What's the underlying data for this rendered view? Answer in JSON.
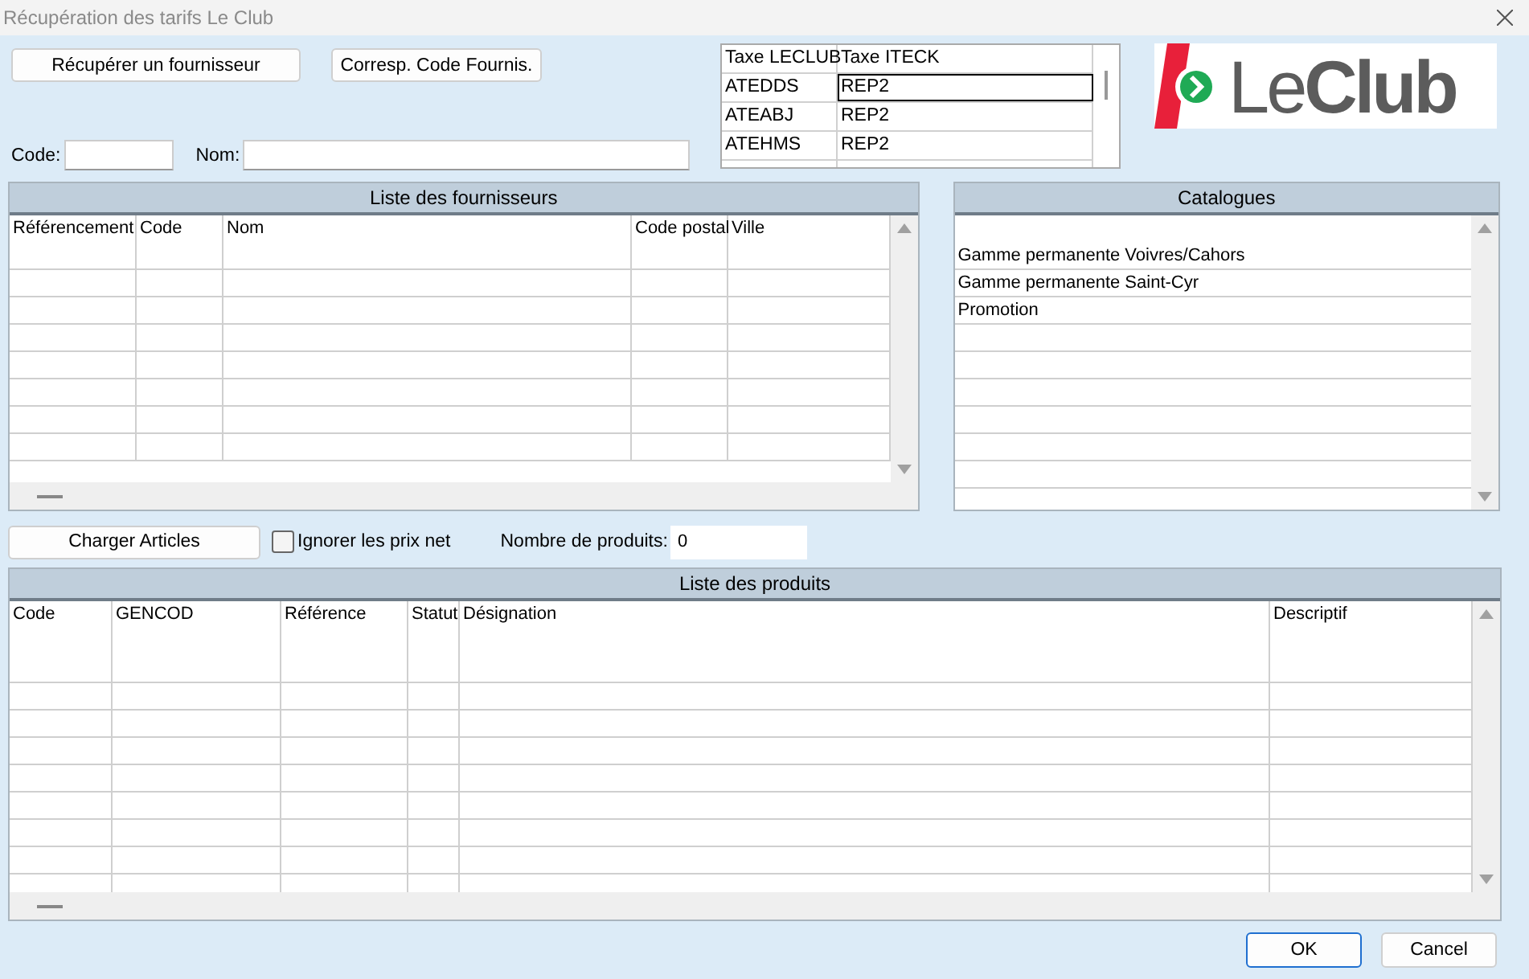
{
  "window": {
    "title": "Récupération des tarifs Le Club"
  },
  "top_buttons": [
    "Récupérer un fournisseur",
    "Corresp. Code Fournis."
  ],
  "filters": [
    {
      "label": "Code:"
    },
    {
      "label": "Nom:"
    }
  ],
  "tax_table": {
    "columns": [
      "Taxe LECLUB",
      "Taxe ITECK"
    ],
    "rows": [
      {
        "cells": [
          "ATEDDS",
          "REP2"
        ],
        "focused": true
      },
      {
        "cells": [
          "ATEABJ",
          "REP2"
        ],
        "focused": false
      },
      {
        "cells": [
          "ATEHMS",
          "REP2"
        ],
        "focused": false
      }
    ]
  },
  "logo": {
    "text": "Le**Club**"
  },
  "suppliers": {
    "title": "Liste des fournisseurs",
    "columns": [
      "Référencement",
      "Code",
      "Nom",
      "Code postal",
      "Ville"
    ]
  },
  "catalogues": {
    "title": "Catalogues",
    "items": [
      {
        "label": "Gamme permanente Voivres/Cahors",
        "selected": false
      },
      {
        "label": "Gamme permanente Saint-Cyr",
        "selected": false
      },
      {
        "label": "Promotion",
        "selected": false
      }
    ]
  },
  "controls": {
    "load_button": "Charger Articles",
    "ignore_net_prices": {
      "label": "Ignorer les prix net",
      "checked": false
    },
    "product_count": {
      "label": "Nombre de produits:",
      "value": "0"
    }
  },
  "products": {
    "title": "Liste des produits",
    "columns": [
      "Code",
      "GENCOD",
      "Référence",
      "Statut",
      "Désignation",
      "Descriptif"
    ]
  },
  "footer_buttons": [
    {
      "label": "OK",
      "default": true
    },
    {
      "label": "Cancel",
      "default": false
    }
  ]
}
